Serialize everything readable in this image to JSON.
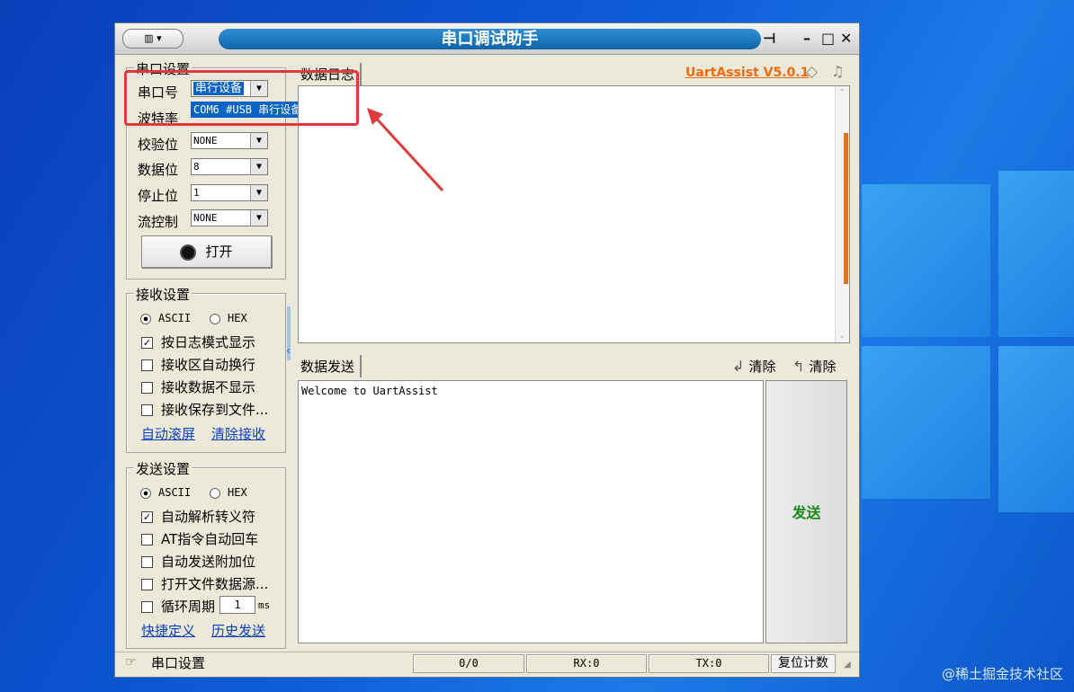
{
  "window": {
    "title": "串口调试助手",
    "menu_glyph": "▥ ▾"
  },
  "serial_settings": {
    "legend": "串口设置",
    "port_label": "串口号",
    "port_value": "串行设备",
    "dropdown_option": "COM6 #USB 串行设备",
    "baud_label": "波特率",
    "parity_label": "校验位",
    "parity_value": "NONE",
    "databits_label": "数据位",
    "databits_value": "8",
    "stopbits_label": "停止位",
    "stopbits_value": "1",
    "flow_label": "流控制",
    "flow_value": "NONE",
    "open_button": "打开"
  },
  "receive_settings": {
    "legend": "接收设置",
    "ascii": "ASCII",
    "hex": "HEX",
    "mode_selected": "ASCII",
    "options": [
      {
        "label": "按日志模式显示",
        "checked": true
      },
      {
        "label": "接收区自动换行",
        "checked": false
      },
      {
        "label": "接收数据不显示",
        "checked": false
      },
      {
        "label": "接收保存到文件...",
        "checked": false
      }
    ],
    "link_autoscroll": "自动滚屏",
    "link_clear": "清除接收"
  },
  "send_settings": {
    "legend": "发送设置",
    "ascii": "ASCII",
    "hex": "HEX",
    "mode_selected": "ASCII",
    "options": [
      {
        "label": "自动解析转义符",
        "checked": true
      },
      {
        "label": "AT指令自动回车",
        "checked": false
      },
      {
        "label": "自动发送附加位",
        "checked": false
      },
      {
        "label": "打开文件数据源...",
        "checked": false
      }
    ],
    "cycle_label": "循环周期",
    "cycle_value": "1",
    "cycle_unit": "ms",
    "link_shortcut": "快捷定义",
    "link_history": "历史发送"
  },
  "log": {
    "tab": "数据日志",
    "version": "UartAssist V5.0.1",
    "accent": "#f26a10"
  },
  "send": {
    "tab": "数据发送",
    "clear1": "清除",
    "clear2": "清除",
    "text": "Welcome to UartAssist",
    "button": "发送"
  },
  "status": {
    "label": "串口设置",
    "counter": "0/0",
    "rx": "RX:0",
    "tx": "TX:0",
    "reset": "复位计数"
  },
  "watermark": "@稀土掘金技术社区"
}
